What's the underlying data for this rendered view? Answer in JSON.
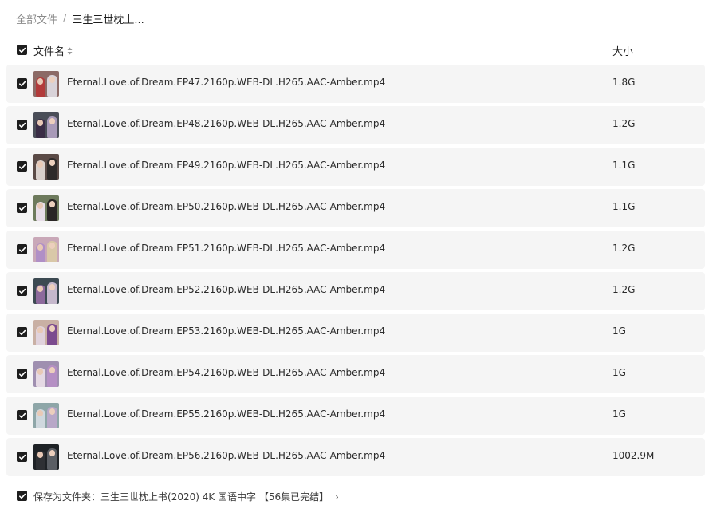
{
  "breadcrumb": {
    "root": "全部文件",
    "separator": "/",
    "current": "三生三世枕上..."
  },
  "header": {
    "name_label": "文件名",
    "size_label": "大小",
    "sort_icon": "sort-icon"
  },
  "files": [
    {
      "name": "Eternal.Love.of.Dream.EP47.2160p.WEB-DL.H265.AAC-Amber.mp4",
      "size": "1.8G",
      "thumb_colors": [
        "#8c6a66",
        "#b23a3a",
        "#d8d2d8"
      ]
    },
    {
      "name": "Eternal.Love.of.Dream.EP48.2160p.WEB-DL.H265.AAC-Amber.mp4",
      "size": "1.2G",
      "thumb_colors": [
        "#4a4e58",
        "#3a2d46",
        "#a89ab8"
      ]
    },
    {
      "name": "Eternal.Love.of.Dream.EP49.2160p.WEB-DL.H265.AAC-Amber.mp4",
      "size": "1.1G",
      "thumb_colors": [
        "#5a4a46",
        "#d9d0cc",
        "#2e2a2a"
      ]
    },
    {
      "name": "Eternal.Love.of.Dream.EP50.2160p.WEB-DL.H265.AAC-Amber.mp4",
      "size": "1.1G",
      "thumb_colors": [
        "#6d7a5c",
        "#e7dde8",
        "#2a2626"
      ]
    },
    {
      "name": "Eternal.Love.of.Dream.EP51.2160p.WEB-DL.H265.AAC-Amber.mp4",
      "size": "1.2G",
      "thumb_colors": [
        "#c9a8b8",
        "#b08fc6",
        "#d9c8a8"
      ]
    },
    {
      "name": "Eternal.Love.of.Dream.EP52.2160p.WEB-DL.H265.AAC-Amber.mp4",
      "size": "1.2G",
      "thumb_colors": [
        "#3c4a52",
        "#8d6a9c",
        "#c5b8cc"
      ]
    },
    {
      "name": "Eternal.Love.of.Dream.EP53.2160p.WEB-DL.H265.AAC-Amber.mp4",
      "size": "1G",
      "thumb_colors": [
        "#c9b0a4",
        "#e0d2dc",
        "#7b4a8e"
      ]
    },
    {
      "name": "Eternal.Love.of.Dream.EP54.2160p.WEB-DL.H265.AAC-Amber.mp4",
      "size": "1G",
      "thumb_colors": [
        "#9f8fb0",
        "#e5d9e4",
        "#b58fc4"
      ]
    },
    {
      "name": "Eternal.Love.of.Dream.EP55.2160p.WEB-DL.H265.AAC-Amber.mp4",
      "size": "1G",
      "thumb_colors": [
        "#8ea6a8",
        "#cfd8de",
        "#b8a8c8"
      ]
    },
    {
      "name": "Eternal.Love.of.Dream.EP56.2160p.WEB-DL.H265.AAC-Amber.mp4",
      "size": "1002.9M",
      "thumb_colors": [
        "#1e2226",
        "#2e3034",
        "#5a5e64"
      ]
    }
  ],
  "footer": {
    "save_label": "保存为文件夹：",
    "folder_name": "三生三世枕上书(2020) 4K 国语中字 【56集已完结】",
    "chevron": "›"
  },
  "colors": {
    "checkbox": "#1e1e1e",
    "row_bg": "#f5f5f5",
    "breadcrumb_root": "#8a8a8a"
  }
}
